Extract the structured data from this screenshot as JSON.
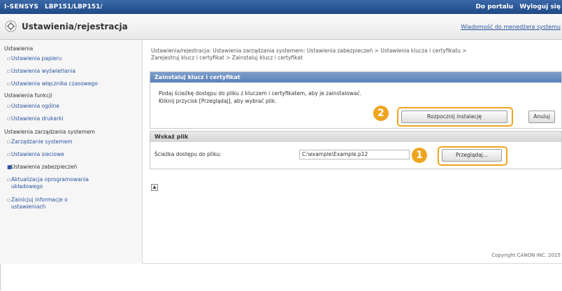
{
  "topbar": {
    "brand": "I-SENSYS",
    "model": "LBP151/LBP151/",
    "portal_link": "Do portalu",
    "logout_link": "Wyloguj się"
  },
  "header": {
    "title": "Ustawienia/rejestracja",
    "admin_message": "Wiadomość do menedżera systemu"
  },
  "sidebar": {
    "section1": "Ustawienia",
    "items1": [
      "Ustawienia papieru",
      "Ustawienia wyświetlania",
      "Ustawienia włącznika czasowego"
    ],
    "section2": "Ustawienia funkcji",
    "items2": [
      "Ustawienia ogólne",
      "Ustawienia drukarki"
    ],
    "section3": "Ustawienia zarządzania systemem",
    "items3": [
      "Zarządzanie systemem",
      "Ustawienia sieciowe",
      "Ustawienia zabezpieczeń"
    ],
    "item_update_line1": "Aktualizacja oprogramowania",
    "item_update_line2": "układowego",
    "item_init_line1": "Zainicjuj informacje o",
    "item_init_line2": "ustawieniach"
  },
  "breadcrumb": {
    "line1": "Ustawienia/rejestracja: Ustawienia zarządzania systemem: Ustawienia zabezpieczeń > Ustawienia klucza i certyfikatu >",
    "line2": "Zarejestruj klucz i certyfikat > Zainstaluj klucz i certyfikat"
  },
  "install_panel": {
    "title": "Zainstaluj klucz i certyfikat",
    "instruction1": "Podaj ścieżkę dostępu do pliku z kluczem i certyfikatem, aby je zainstalować.",
    "instruction2": "Kliknij przycisk [Przeglądaj], aby wybrać plik.",
    "start_label": "Rozpocznij instalację",
    "cancel_label": "Anuluj"
  },
  "file_panel": {
    "title": "Wskaż plik",
    "path_label": "Ścieżka dostępu do pliku:",
    "path_value": "C:\\example\\Example.p12",
    "browse_label": "Przeglądaj..."
  },
  "callouts": {
    "one": "1",
    "two": "2"
  },
  "footer": {
    "copyright": "Copyright CANON INC. 2015"
  },
  "colors": {
    "accent_orange": "#f0a51e",
    "link_blue": "#2a55a0",
    "topbar_blue": "#1f4a86"
  }
}
